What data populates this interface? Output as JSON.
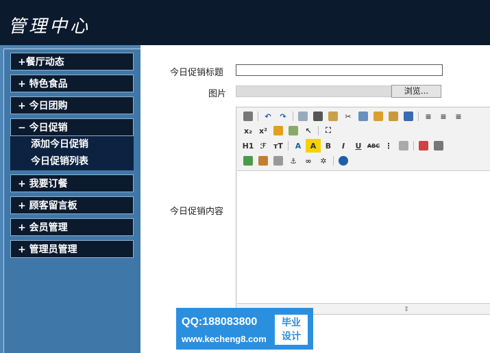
{
  "header": {
    "logo": "管理中心"
  },
  "sidebar": {
    "items": [
      {
        "label": "+餐厅动态"
      },
      {
        "label": "+ 特色食品"
      },
      {
        "label": "+ 今日团购"
      },
      {
        "label": "− 今日促销"
      },
      {
        "label": "+ 我要订餐"
      },
      {
        "label": "+ 顾客留言板"
      },
      {
        "label": "+ 会员管理"
      },
      {
        "label": "+ 管理员管理"
      }
    ],
    "subitems": [
      {
        "label": "添加今日促销"
      },
      {
        "label": "今日促销列表"
      }
    ]
  },
  "form": {
    "title_label": "今日促销标题",
    "title_value": "",
    "image_label": "图片",
    "browse_label": "浏览...",
    "content_label": "今日促销内容"
  },
  "editor": {
    "row2": [
      "x₂",
      "x²"
    ],
    "row3": [
      "H1",
      "ℱ",
      "тT",
      "A",
      "A",
      "B",
      "I",
      "U",
      "ABC"
    ]
  },
  "watermark": {
    "qq": "QQ:188083800",
    "site": "www.kecheng8.com",
    "badge_line1": "毕业",
    "badge_line2": "设计"
  },
  "colors": {
    "header_bg": "#0c1a2e",
    "sidebar_bg": "#4e86b6",
    "menu_bg": "#0c1a2e",
    "watermark_bg": "#2b8fe0"
  }
}
